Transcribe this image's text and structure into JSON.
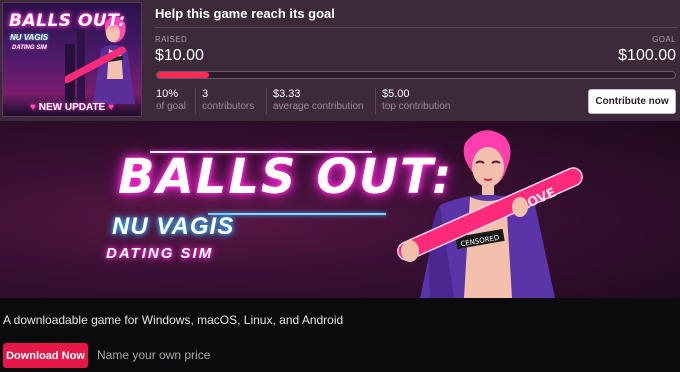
{
  "thumbnail": {
    "title": "BALLS OUT:",
    "subtitle1": "NU VAGIS",
    "subtitle2": "DATING SIM",
    "badge": "NEW UPDATE"
  },
  "goal": {
    "heading": "Help this game reach its goal",
    "raised_label": "RAISED",
    "raised_value": "$10.00",
    "goal_label": "GOAL",
    "goal_value": "$100.00",
    "progress_fraction": 0.1,
    "stats": [
      {
        "value": "10%",
        "label": "of goal"
      },
      {
        "value": "3",
        "label": "contributors"
      },
      {
        "value": "$3.33",
        "label": "average contribution"
      },
      {
        "value": "$5.00",
        "label": "top contribution"
      }
    ],
    "contribute_label": "Contribute now"
  },
  "banner": {
    "title": "BALLS OUT:",
    "subtitle1": "NU VAGIS",
    "subtitle2": "DATING SIM",
    "bat_text": "LOVE",
    "tag_text": "CENSORED"
  },
  "description": "A downloadable game for Windows, macOS, Linux, and Android",
  "download_label": "Download Now",
  "price_text": "Name your own price",
  "colors": {
    "accent": "#ff2a55",
    "download_button": "#e8174a",
    "goal_panel": "#3c2a3a",
    "neon_pink": "#ff2ad6",
    "neon_blue": "#2fb8ff"
  }
}
